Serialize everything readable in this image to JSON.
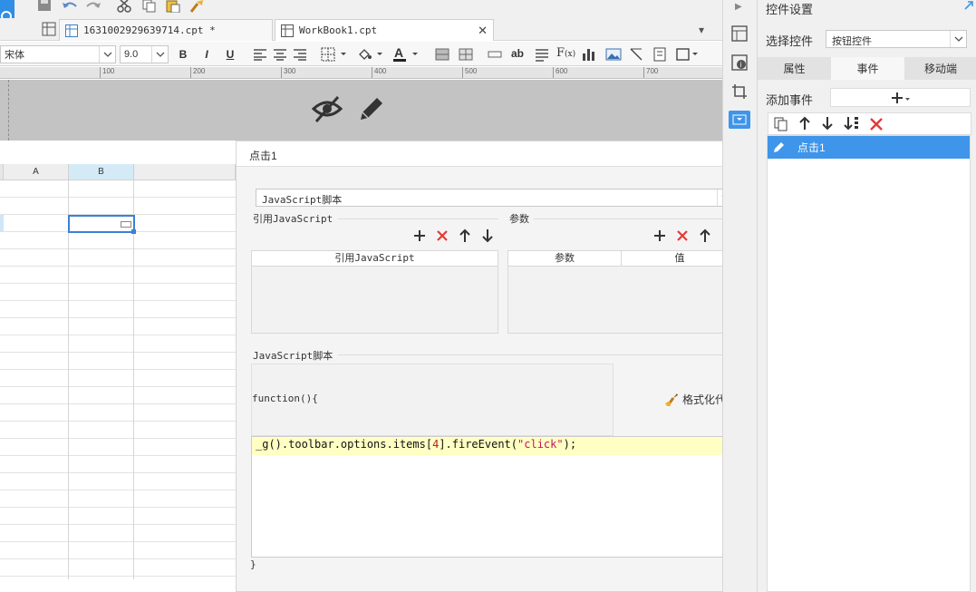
{
  "tabs": [
    {
      "label": "1631002929639714.cpt *"
    },
    {
      "label": "WorkBook1.cpt"
    }
  ],
  "format_toolbar": {
    "font_name": "宋体",
    "font_size": "9.0",
    "bold": "B",
    "italic": "I",
    "underline": "U"
  },
  "ruler": {
    "marks": [
      "100",
      "200",
      "300",
      "400",
      "500",
      "600",
      "700"
    ]
  },
  "sheet": {
    "columns": [
      "A",
      "B"
    ]
  },
  "dialog": {
    "title": "点击1",
    "script_type": "JavaScript脚本",
    "ref_js_group": "引用JavaScript",
    "ref_js_header": "引用JavaScript",
    "params_group": "参数",
    "params_header_name": "参数",
    "params_header_value": "值",
    "script_group": "JavaScript脚本",
    "function_open": "function(){",
    "format_code": "格式化代码",
    "code": {
      "p1": "_g",
      "p2": "().toolbar.options.items[",
      "num": "4",
      "p3": "].fireEvent(",
      "str": "\"click\"",
      "p4": ");"
    },
    "function_close": "}"
  },
  "panel": {
    "title": "控件设置",
    "select_label": "选择控件",
    "select_value": "按钮控件",
    "tabs": [
      "属性",
      "事件",
      "移动端"
    ],
    "add_event_label": "添加事件",
    "events": [
      {
        "label": "点击1"
      }
    ]
  },
  "colors": {
    "accent": "#3e95ea",
    "danger": "#e53935",
    "code_highlight": "#ffffc4"
  }
}
